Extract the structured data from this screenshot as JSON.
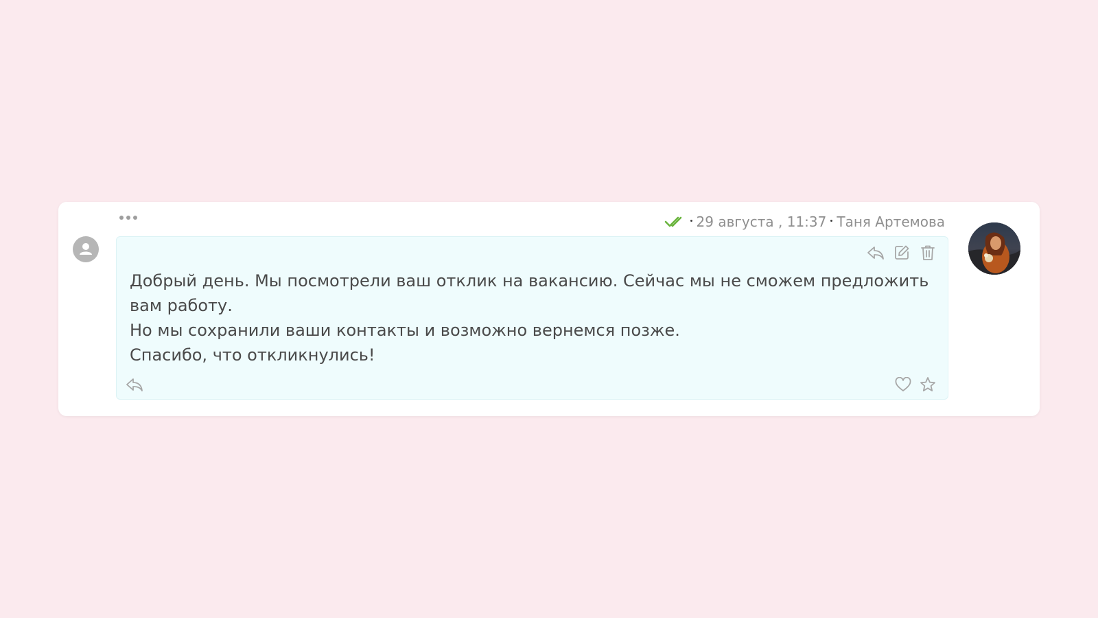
{
  "message": {
    "date": "29 августа , 11:37",
    "author": "Таня Артемова",
    "lines": [
      "Добрый день. Мы посмотрели ваш отклик на вакансию. Сейчас мы не сможем предложить вам работу.",
      "Но мы сохранили ваши контакты и возможно вернемся позже.",
      "Спасибо, что откликнулись!"
    ],
    "bubble_color": "#effcfd",
    "read_status_color": "#6ab43e"
  },
  "icons": {
    "more": "more-dots-icon",
    "read_status": "double-check-icon",
    "reply": "reply-icon",
    "edit": "edit-icon",
    "delete": "trash-icon",
    "like": "heart-icon",
    "favorite": "star-icon"
  }
}
